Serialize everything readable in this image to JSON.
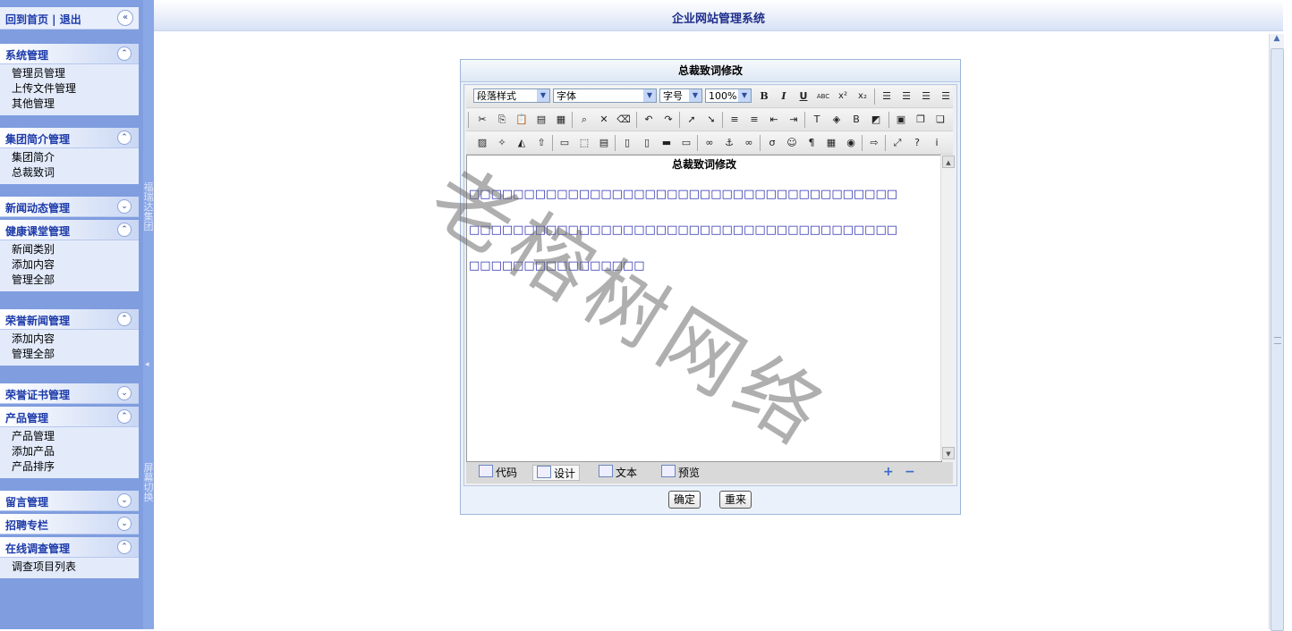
{
  "header": {
    "title": "企业网站管理系统"
  },
  "sidebar": {
    "top_links": "回到首页 | 退出",
    "collapse_all_icon": "chevron-double-left",
    "groups": [
      {
        "title": "系统管理",
        "items": [
          "管理员管理",
          "上传文件管理",
          "其他管理"
        ]
      },
      {
        "title": "集团简介管理",
        "items": [
          "集团简介",
          "总裁致词"
        ]
      },
      {
        "title": "新闻动态管理",
        "items": []
      },
      {
        "title": "健康课堂管理",
        "items": [
          "新闻类别",
          "添加内容",
          "管理全部"
        ]
      },
      {
        "title": "荣誉新闻管理",
        "items": [
          "添加内容",
          "管理全部"
        ]
      },
      {
        "title": "荣誉证书管理",
        "items": []
      },
      {
        "title": "产品管理",
        "items": [
          "产品管理",
          "添加产品",
          "产品排序"
        ]
      },
      {
        "title": "留言管理",
        "items": []
      },
      {
        "title": "招聘专栏",
        "items": []
      },
      {
        "title": "在线调查管理",
        "items": [
          "调查项目列表"
        ]
      }
    ]
  },
  "splitter": {
    "label_top": "福瑞达集团",
    "label_bottom": "屏幕切换"
  },
  "editor": {
    "window_title": "总裁致词修改",
    "paragraph_style": "段落样式",
    "font": "字体",
    "font_size": "字号",
    "zoom": "100%",
    "content_title": "总裁致词修改",
    "content_lines": [
      "□□□□□□□□□□□□□□□□□□□□□□□□□□□□□□□□□□□□□□□",
      "□□□□□□□□□□□□□□□□□□□□□□□□□□□□□□□□□□□□□□□",
      "□□□□□□□□□□□□□□□□"
    ],
    "modes": {
      "code": "代码",
      "design": "设计",
      "text": "文本",
      "preview": "预览"
    },
    "zoom_in": "+",
    "zoom_out": "−"
  },
  "buttons": {
    "confirm": "确定",
    "reset": "重来"
  },
  "watermark": "老榕树网络"
}
